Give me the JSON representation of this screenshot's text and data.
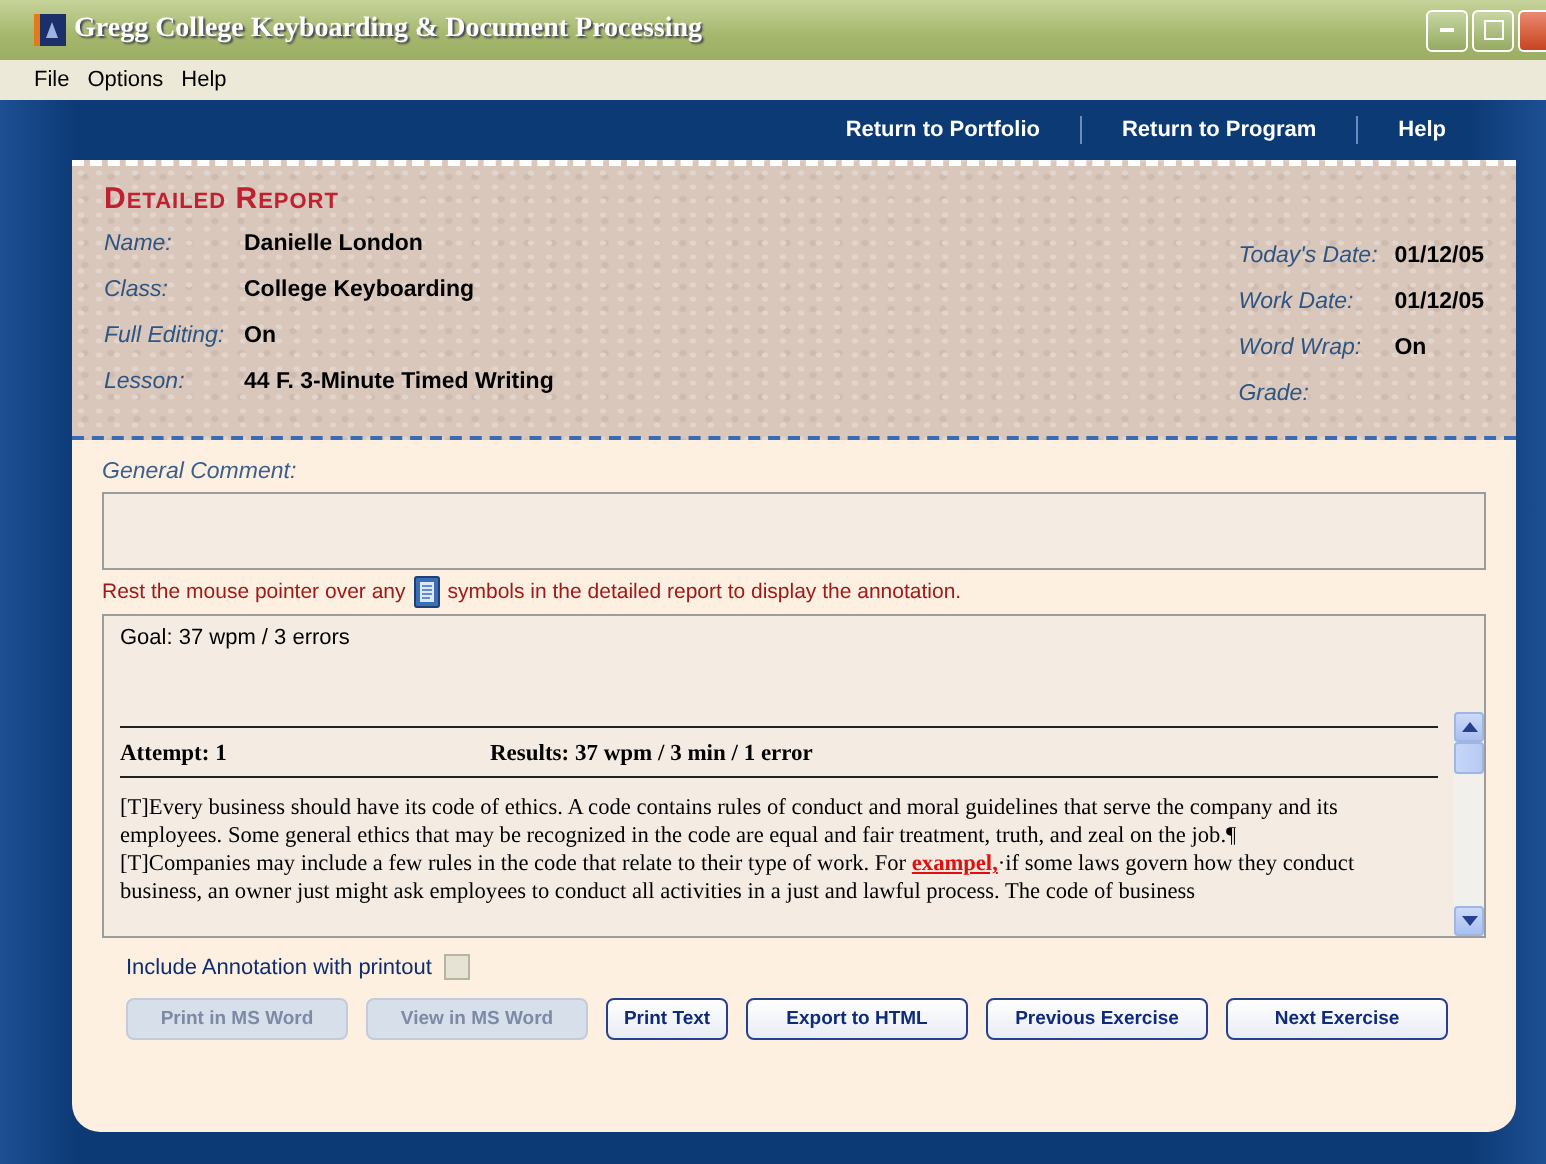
{
  "window": {
    "title": "Gregg College Keyboarding & Document Processing"
  },
  "menu": [
    "File",
    "Options",
    "Help"
  ],
  "nav": [
    "Return to Portfolio",
    "Return to Program",
    "Help"
  ],
  "report": {
    "title": "Detailed Report",
    "left_fields": [
      {
        "label": "Name:",
        "value": "Danielle London"
      },
      {
        "label": "Class:",
        "value": "College Keyboarding"
      },
      {
        "label": "Full Editing:",
        "value": "On"
      },
      {
        "label": "Lesson:",
        "value": "44 F.  3-Minute Timed Writing"
      }
    ],
    "right_fields": [
      {
        "label": "Today's Date:",
        "value": "01/12/05"
      },
      {
        "label": "Work Date:",
        "value": "01/12/05"
      },
      {
        "label": "Word Wrap:",
        "value": "On"
      },
      {
        "label": "Grade:"
      }
    ]
  },
  "general_comment": {
    "label": "General Comment:"
  },
  "hint": {
    "before": "Rest the mouse pointer over any",
    "after": "symbols in the detailed report to display the annotation."
  },
  "detail": {
    "goal": "Goal:  37 wpm / 3 errors",
    "attempt": "Attempt:  1",
    "results": "Results: 37 wpm / 3 min / 1 error",
    "paragraphs": [
      [
        {
          "kind": "normal",
          "text": "[T]Every business should have its code of ethics. A code contains rules of conduct and moral guidelines that serve the company and its employees. Some general ethics that may be recognized in the code are equal and fair treatment, truth, and zeal on the job.¶"
        }
      ],
      [
        {
          "kind": "normal",
          "text": "[T]Companies may include a few rules in the code that relate to their type of work. For "
        },
        {
          "kind": "error",
          "text": "exampel,"
        },
        {
          "kind": "normal",
          "text": "·if some laws govern how they conduct business, an owner just might ask employees to conduct all activities in a just and lawful process. The code of business"
        }
      ]
    ]
  },
  "include_annotation": {
    "label": "Include Annotation with printout",
    "checked": false,
    "disabled": true
  },
  "buttons": [
    {
      "label": "Print in MS Word",
      "disabled": true
    },
    {
      "label": "View in MS Word",
      "disabled": true
    },
    {
      "label": "Print Text",
      "disabled": false
    },
    {
      "label": "Export to HTML",
      "disabled": false
    },
    {
      "label": "Previous Exercise",
      "disabled": false
    },
    {
      "label": "Next Exercise",
      "disabled": false
    }
  ]
}
